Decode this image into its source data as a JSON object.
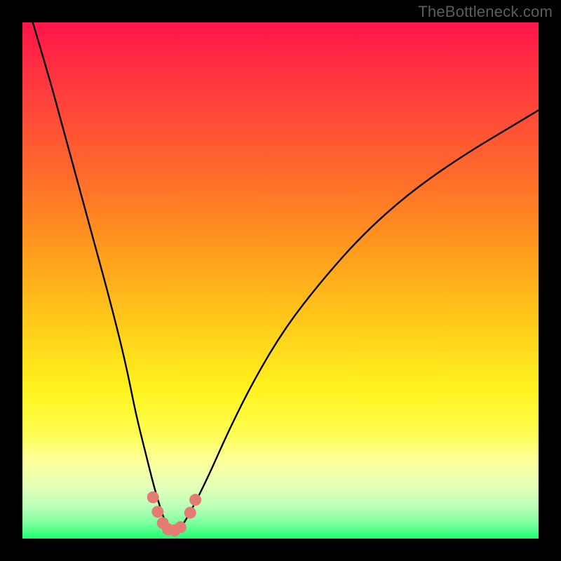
{
  "watermark": "TheBottleneck.com",
  "colors": {
    "frame": "#000000",
    "gradient_top": "#ff154a",
    "gradient_bottom": "#1eff73",
    "curve": "#000000",
    "dots": "#e47b72"
  },
  "chart_data": {
    "type": "line",
    "title": "",
    "xlabel": "",
    "ylabel": "",
    "xlim": [
      0,
      100
    ],
    "ylim": [
      0,
      100
    ],
    "grid": false,
    "series": [
      {
        "name": "curve",
        "x": [
          2,
          5,
          8,
          11,
          14,
          17,
          20,
          22,
          24,
          25.5,
          27,
          28,
          29,
          30,
          31,
          33,
          36,
          40,
          45,
          51,
          58,
          66,
          75,
          85,
          95,
          100
        ],
        "y": [
          100,
          90,
          79,
          68,
          57,
          46,
          34,
          24,
          16,
          10,
          5,
          2.5,
          1.5,
          1.5,
          2.5,
          6,
          12,
          21,
          31,
          41,
          50,
          59,
          67,
          74,
          80,
          83
        ]
      }
    ],
    "annotations": {
      "dots_near_minimum": [
        {
          "x": 25.3,
          "y": 8.0
        },
        {
          "x": 26.2,
          "y": 5.2
        },
        {
          "x": 27.2,
          "y": 3.0
        },
        {
          "x": 28.2,
          "y": 1.8
        },
        {
          "x": 29.5,
          "y": 1.6
        },
        {
          "x": 30.6,
          "y": 2.2
        },
        {
          "x": 32.5,
          "y": 5.0
        },
        {
          "x": 33.5,
          "y": 7.5
        }
      ]
    }
  }
}
